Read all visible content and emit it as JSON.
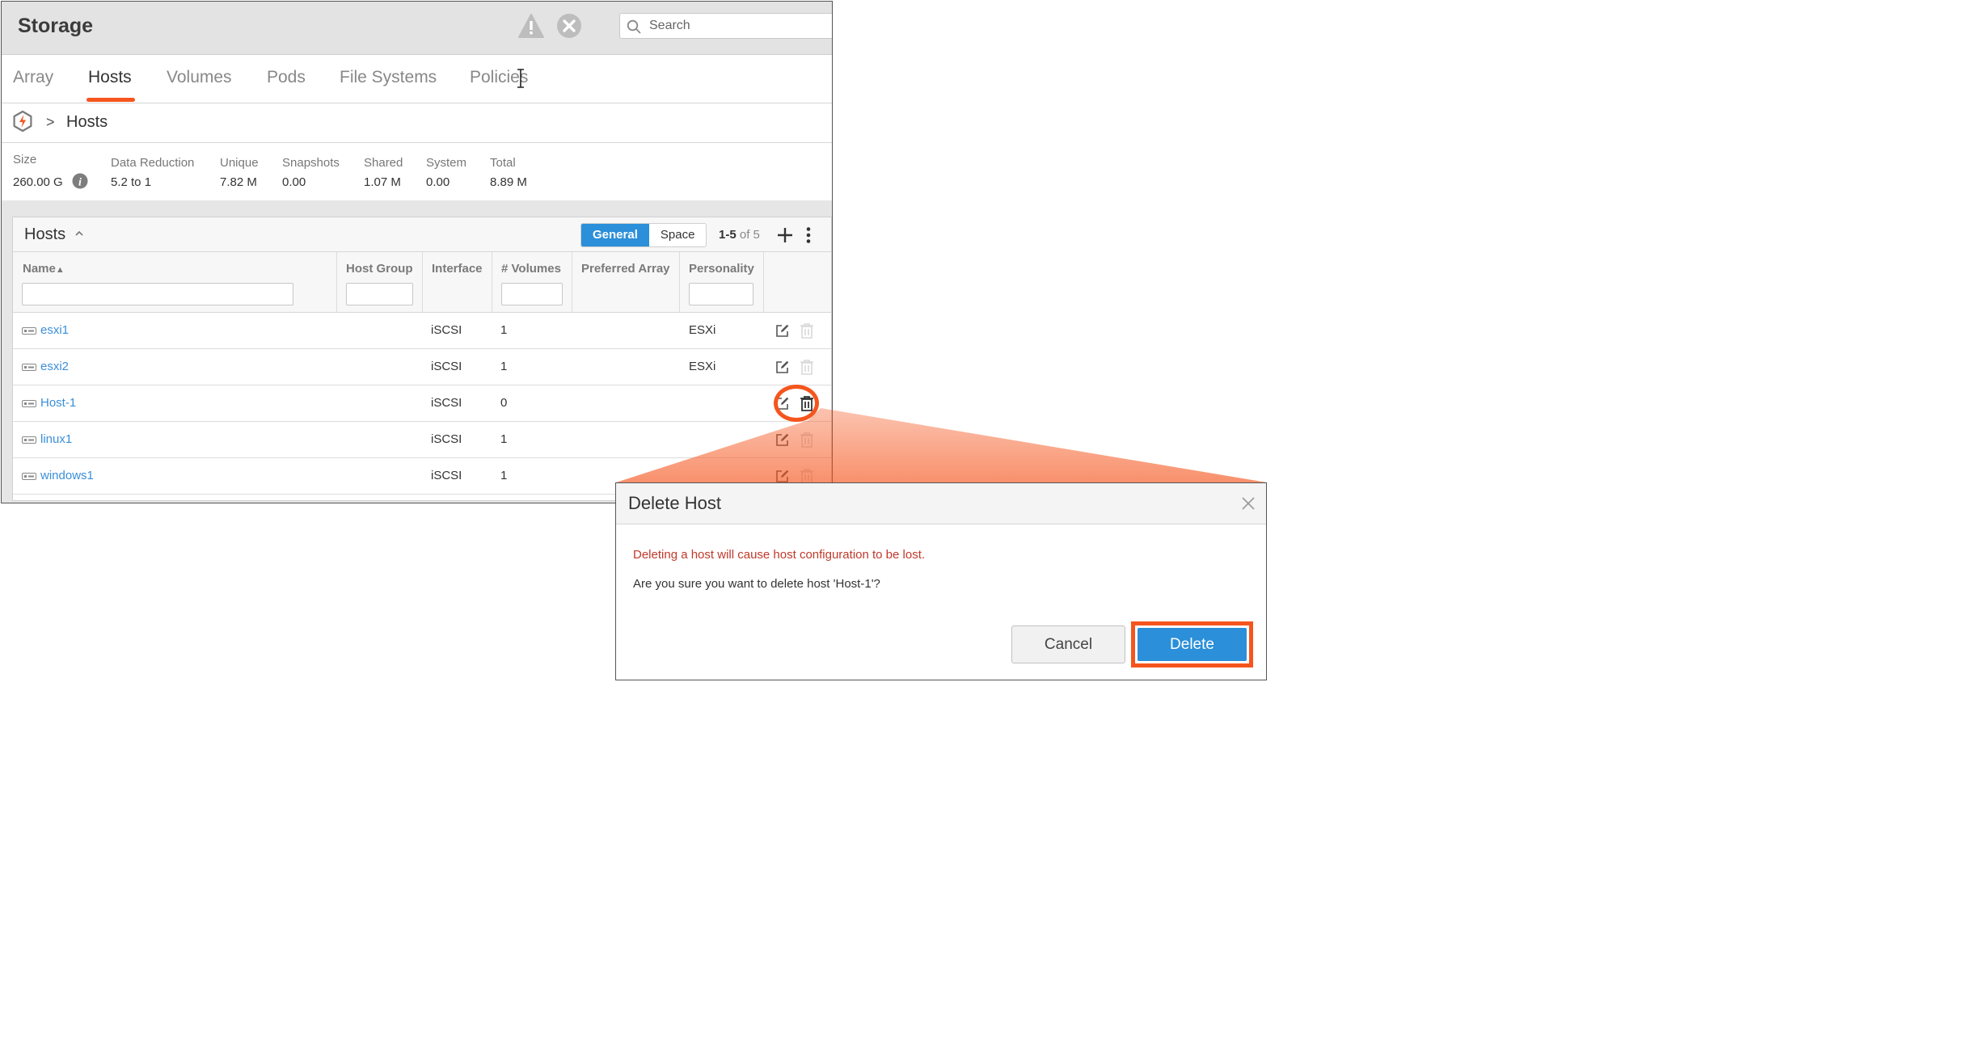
{
  "header": {
    "title": "Storage",
    "search_placeholder": "Search"
  },
  "tabs": [
    {
      "label": "Array"
    },
    {
      "label": "Hosts",
      "active": true
    },
    {
      "label": "Volumes"
    },
    {
      "label": "Pods"
    },
    {
      "label": "File Systems"
    },
    {
      "label": "Policies"
    }
  ],
  "breadcrumb": {
    "separator": ">",
    "current": "Hosts"
  },
  "stats": [
    {
      "label": "Size",
      "value": "260.00 G"
    },
    {
      "label": "Data Reduction",
      "value": "5.2 to 1"
    },
    {
      "label": "Unique",
      "value": "7.82 M"
    },
    {
      "label": "Snapshots",
      "value": "0.00"
    },
    {
      "label": "Shared",
      "value": "1.07 M"
    },
    {
      "label": "System",
      "value": "0.00"
    },
    {
      "label": "Total",
      "value": "8.89 M"
    }
  ],
  "hosts_panel": {
    "title": "Hosts",
    "view_general": "General",
    "view_space": "Space",
    "pager_range": "1-5",
    "pager_of": "of 5",
    "columns": [
      "Name",
      "Host Group",
      "Interface",
      "# Volumes",
      "Preferred Array",
      "Personality"
    ],
    "sort_indicator": "▲",
    "rows": [
      {
        "name": "esxi1",
        "interface": "iSCSI",
        "volumes": "1",
        "personality": "ESXi"
      },
      {
        "name": "esxi2",
        "interface": "iSCSI",
        "volumes": "1",
        "personality": "ESXi"
      },
      {
        "name": "Host-1",
        "interface": "iSCSI",
        "volumes": "0",
        "personality": ""
      },
      {
        "name": "linux1",
        "interface": "iSCSI",
        "volumes": "1",
        "personality": ""
      },
      {
        "name": "windows1",
        "interface": "iSCSI",
        "volumes": "1",
        "personality": ""
      }
    ]
  },
  "dialog": {
    "title": "Delete Host",
    "warning": "Deleting a host will cause host configuration to be lost.",
    "question": "Are you sure you want to delete host 'Host-1'?",
    "cancel_label": "Cancel",
    "delete_label": "Delete"
  },
  "colors": {
    "accent_orange": "#f5551d",
    "primary_blue": "#2b8fd9",
    "link_blue": "#3a8fd9",
    "warning_red": "#c0392b"
  }
}
